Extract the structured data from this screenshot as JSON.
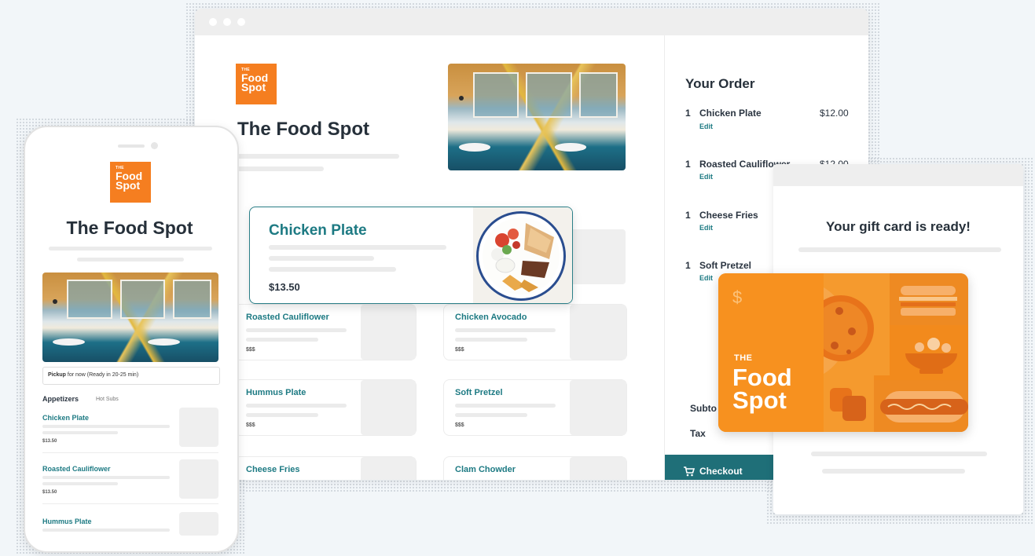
{
  "brand": {
    "logo_the": "THE",
    "logo_word1": "Food",
    "logo_word2": "Spot",
    "name": "The Food Spot",
    "accent": "#f57e20",
    "teal": "#1d7a83"
  },
  "desktop": {
    "featured": {
      "name": "Chicken Plate",
      "price": "$13.50"
    },
    "menu_cards": [
      {
        "name": "Roasted Cauliflower",
        "price": "$$$"
      },
      {
        "name": "Chicken Avocado",
        "price": "$$$"
      },
      {
        "name": "Hummus Plate",
        "price": "$$$"
      },
      {
        "name": "Soft Pretzel",
        "price": "$$$"
      },
      {
        "name": "Cheese Fries"
      },
      {
        "name": "Clam Chowder"
      }
    ],
    "order": {
      "title": "Your Order",
      "items": [
        {
          "qty": "1",
          "name": "Chicken Plate",
          "price": "$12.00",
          "edit": "Edit"
        },
        {
          "qty": "1",
          "name": "Roasted Cauliflower",
          "price": "$12.00",
          "edit": "Edit"
        },
        {
          "qty": "1",
          "name": "Cheese Fries",
          "edit": "Edit"
        },
        {
          "qty": "1",
          "name": "Soft Pretzel",
          "edit": "Edit"
        }
      ],
      "subtotal_label": "Subto",
      "tax_label": "Tax",
      "checkout_label": "Checkout"
    }
  },
  "mobile": {
    "pickup_bold": "Pickup",
    "pickup_rest": " for now (Ready in 20-25 min)",
    "tabs": [
      "Appetizers",
      "Hot Subs"
    ],
    "items": [
      {
        "name": "Chicken Plate",
        "price": "$13.50"
      },
      {
        "name": "Roasted Cauliflower",
        "price": "$13.50"
      },
      {
        "name": "Hummus Plate"
      }
    ]
  },
  "gift": {
    "title": "Your gift card is ready!",
    "currency": "$",
    "the": "THE",
    "word1": "Food",
    "word2": "Spot"
  }
}
